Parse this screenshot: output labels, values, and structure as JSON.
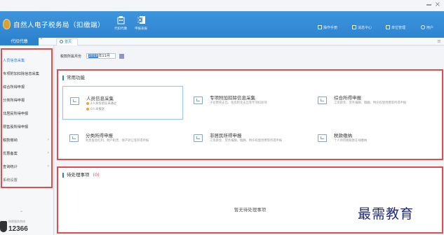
{
  "header": {
    "app_title": "自然人电子税务局（扣缴端）",
    "tools": [
      {
        "label": "代扣代缴",
        "icon": "building-icon"
      },
      {
        "label": "申报表报",
        "icon": "excel-icon"
      }
    ],
    "links": [
      {
        "label": "操作手册",
        "icon": "manual-icon"
      },
      {
        "label": "消息中心",
        "icon": "message-icon"
      },
      {
        "label": "单位管理",
        "icon": "unit-icon"
      },
      {
        "label": "用户",
        "icon": "user-icon"
      }
    ]
  },
  "tabbar": {
    "sidebar_title": "代扣代缴",
    "home_tab": "首页",
    "collapse_glyph": "⌄"
  },
  "sidebar": {
    "items": [
      {
        "label": "人员信息采集",
        "arrow": ""
      },
      {
        "label": "专项附加扣除信息采集",
        "arrow": ""
      },
      {
        "label": "综合所得申报",
        "arrow": ""
      },
      {
        "label": "分类所得申报",
        "arrow": ""
      },
      {
        "label": "非居民所得申报",
        "arrow": ""
      },
      {
        "label": "限售股所得申报",
        "arrow": ""
      },
      {
        "label": "税款缴纳",
        "arrow": "›"
      },
      {
        "label": "优惠备案",
        "arrow": "›"
      },
      {
        "label": "查询统计",
        "arrow": "›"
      },
      {
        "label": "系统设置",
        "arrow": ""
      }
    ],
    "hotline_label": "纳税服务热线",
    "hotline_number": "12366"
  },
  "main": {
    "period_label": "税款所属月份",
    "period_value_highlight": "2019",
    "period_value_rest": "年11月"
  },
  "common_functions": {
    "title": "常用功能",
    "items": [
      {
        "title": "人员信息采集",
        "lines": [
          "2人身份验证未通过",
          "0人未报送"
        ],
        "icon": "person-card-icon"
      },
      {
        "title": "专项附加扣除信息采集",
        "desc": "子女教育支出、住房租金支出等专项扣除项",
        "icon": "id-card-icon"
      },
      {
        "title": "综合所得申报",
        "desc": "工资薪金、劳务报酬、稿酬、特许权使用费等所得申报",
        "icon": "doc-icon"
      },
      {
        "title": "分类所得申报",
        "desc": "利息股息红利、财产租赁、财产转让等所得申报",
        "icon": "edit-icon"
      },
      {
        "title": "非居民所得申报",
        "desc": "工资薪金、劳务报酬、稿酬、特许权使用费等所得申报",
        "icon": "edit-icon"
      },
      {
        "title": "税款缴纳",
        "desc": "个人所得税税款在线缴纳",
        "icon": "pay-icon"
      }
    ]
  },
  "pending": {
    "title": "待处理事项",
    "count": "(0)",
    "empty_text": "暂无待处理事项"
  },
  "watermark": "最需教育"
}
